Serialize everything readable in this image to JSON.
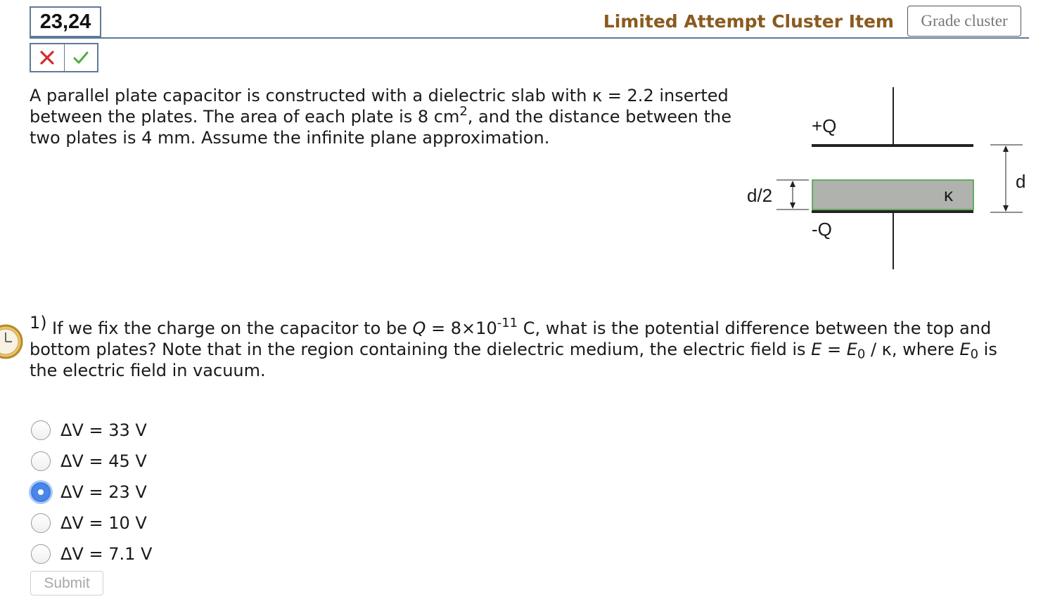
{
  "header": {
    "item_id": "23,24",
    "item_type": "Limited Attempt Cluster Item",
    "grade_button": "Grade cluster"
  },
  "marks": {
    "wrong_icon": "x-mark-icon",
    "correct_icon": "check-mark-icon"
  },
  "problem": {
    "intro_a": "A parallel plate capacitor is constructed with a dielectric slab with κ = 2.2 inserted between the plates. The area of each plate is 8 cm",
    "intro_sup": "2",
    "intro_b": ", and the distance between the two plates is 4 mm. Assume the infinite plane approximation."
  },
  "diagram": {
    "top_charge": "+Q",
    "bottom_charge": "-Q",
    "slab_label": "d/2",
    "kappa": "κ",
    "gap_label": "d",
    "slab_color": "#b0b2ae"
  },
  "question": {
    "number": "1)",
    "part1": "If we fix the charge on the capacitor to be ",
    "q_var": "Q",
    "part2": " = 8×10",
    "exp": "-11",
    "part3": " C, what is the potential difference between the top and bottom plates? Note that in the region containing the dielectric medium, the electric field is ",
    "e_var": "E",
    "part4": " = ",
    "e0_var": "E",
    "e0_sub": "0",
    "part5": " / κ, where ",
    "e0b_var": "E",
    "e0b_sub": "0",
    "part6": " is the electric field in vacuum."
  },
  "choices": [
    {
      "label": "ΔV = 33 V",
      "selected": false
    },
    {
      "label": "ΔV = 45 V",
      "selected": false
    },
    {
      "label": "ΔV = 23 V",
      "selected": true
    },
    {
      "label": "ΔV = 10 V",
      "selected": false
    },
    {
      "label": "ΔV = 7.1 V",
      "selected": false
    }
  ],
  "submit_label": "Submit",
  "colors": {
    "accent": "#8a5a1e",
    "frame": "#5f7a96",
    "selected": "#4a86ea",
    "wrong": "#d62b2b",
    "correct": "#4caf3e"
  }
}
